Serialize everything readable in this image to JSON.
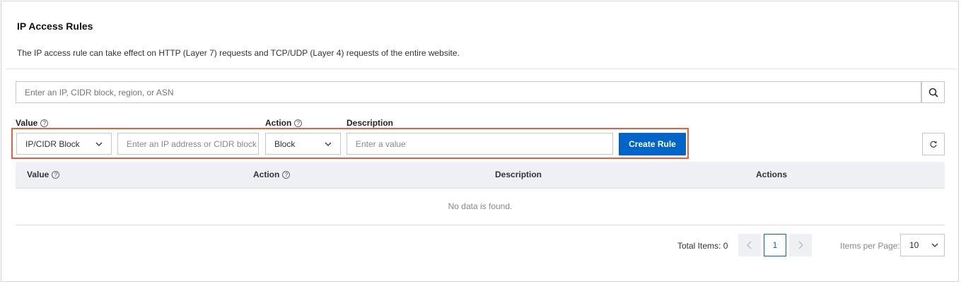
{
  "header": {
    "title": "IP Access Rules",
    "subtitle": "The IP access rule can take effect on HTTP (Layer 7) requests and TCP/UDP (Layer 4) requests of the entire website."
  },
  "search": {
    "placeholder": "Enter an IP, CIDR block, region, or ASN",
    "icon": "search-icon"
  },
  "form": {
    "value_label": "Value",
    "action_label": "Action",
    "description_label": "Description",
    "type_select_value": "IP/CIDR Block",
    "ip_input_placeholder": "Enter an IP address or CIDR block",
    "action_select_value": "Block",
    "description_placeholder": "Enter a value",
    "create_button": "Create Rule",
    "help_glyph": "?"
  },
  "table": {
    "columns": [
      "Value",
      "Action",
      "Description",
      "Actions"
    ],
    "empty_text": "No data is found."
  },
  "pagination": {
    "total_label": "Total Items: 0",
    "current_page": "1",
    "items_per_page_label": "Items per Page:",
    "items_per_page_value": "10"
  },
  "colors": {
    "primary": "#0064c8",
    "highlight": "#e5603f"
  }
}
